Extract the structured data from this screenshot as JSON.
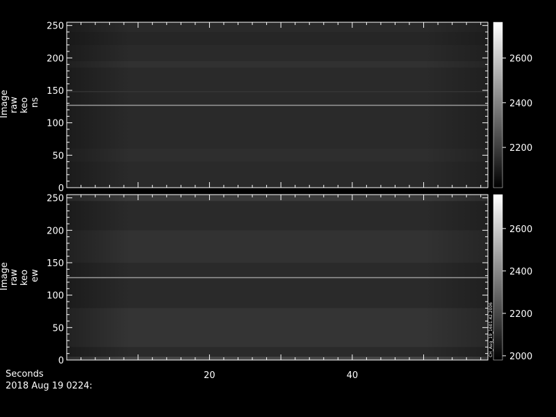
{
  "colors": {
    "background": "#000000",
    "axis": "#ffffff",
    "image_base": "#2a2a2a",
    "bright_line": "#9a9a9a"
  },
  "chart_data": [
    {
      "type": "heatmap",
      "ylabel_lines": [
        "Image",
        "raw",
        "keo",
        "ns"
      ],
      "x_range": [
        0,
        59
      ],
      "y_range": [
        0,
        255
      ],
      "y_ticks": [
        0,
        50,
        100,
        150,
        200,
        250
      ],
      "colorbar": {
        "range": [
          2020,
          2760
        ],
        "ticks": [
          2200,
          2400,
          2600
        ]
      },
      "bright_row_y": 127,
      "faint_row_y": 148
    },
    {
      "type": "heatmap",
      "ylabel_lines": [
        "Image",
        "raw",
        "keo",
        "ew"
      ],
      "x_range": [
        0,
        59
      ],
      "y_range": [
        0,
        255
      ],
      "y_ticks": [
        0,
        50,
        100,
        150,
        200,
        250
      ],
      "colorbar": {
        "range": [
          1980,
          2760
        ],
        "ticks": [
          2000,
          2200,
          2400,
          2600
        ]
      },
      "colorbar_note": "CH_Aug_19_1601.42.2006",
      "bright_row_y": 127
    }
  ],
  "x_axis": {
    "label": "Seconds",
    "ticks": [
      20,
      40
    ]
  },
  "footer": {
    "date": "2018 Aug 19 0224:"
  }
}
